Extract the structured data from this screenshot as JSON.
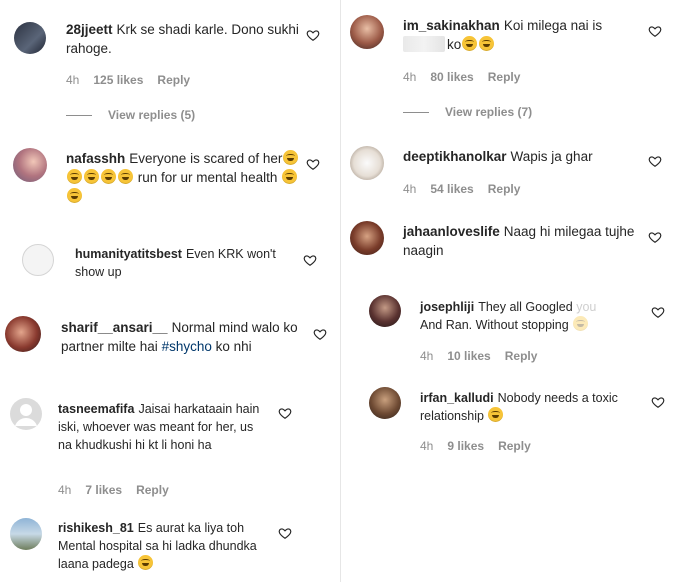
{
  "left": [
    {
      "user": "28jjeett",
      "text": "Krk se shadi karle. Dono sukhi rahoge.",
      "time": "4h",
      "likes": "125 likes",
      "reply": "Reply",
      "view_replies": "View replies (5)"
    },
    {
      "user": "nafasshh",
      "text_a": "Everyone is scared of her",
      "text_b": "run for ur mental health"
    },
    {
      "user": "humanityatitsbest",
      "text": "Even KRK won't show up"
    },
    {
      "user": "sharif__ansari__",
      "text_a": "Normal mind walo ko partner milte hai",
      "hashtag": "#shycho",
      "text_b": "ko nhi"
    },
    {
      "user": "tasneemafifa",
      "text": "Jaisai harkataain hain iski, whoever was meant for her, us na khudkushi hi kt li honi ha",
      "time": "4h",
      "likes": "7 likes",
      "reply": "Reply"
    },
    {
      "user": "rishikesh_81",
      "text": "Es aurat ka liya toh Mental hospital sa hi ladka dhundka laana padega"
    }
  ],
  "right": [
    {
      "user": "im_sakinakhan",
      "text_a": "Koi milega nai is",
      "text_b": "ko",
      "time": "4h",
      "likes": "80 likes",
      "reply": "Reply",
      "view_replies": "View replies (7)"
    },
    {
      "user": "deeptikhanolkar",
      "text": "Wapis ja ghar",
      "time": "4h",
      "likes": "54 likes",
      "reply": "Reply"
    },
    {
      "user": "jahaanloveslife",
      "text": "Naag hi milegaa tujhe naagin"
    },
    {
      "user": "josephliji",
      "text_a": "They all Googled",
      "faded": "you",
      "text_b": "And Ran. Without stopping",
      "time": "4h",
      "likes": "10 likes",
      "reply": "Reply"
    },
    {
      "user": "irfan_kalludi",
      "text": "Nobody needs a toxic relationship",
      "time": "4h",
      "likes": "9 likes",
      "reply": "Reply"
    }
  ],
  "colors": {
    "text": "#262626",
    "meta": "#8e8e8e",
    "hashtag": "#00376b",
    "emoji": "#f7c437"
  }
}
